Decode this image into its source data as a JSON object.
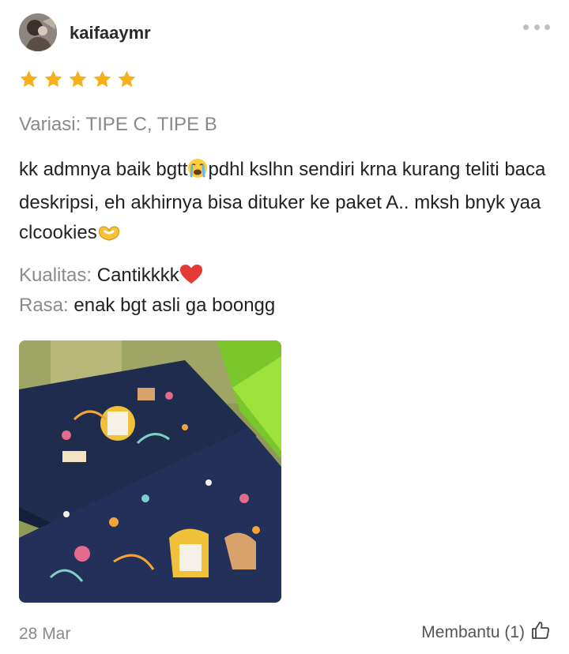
{
  "review": {
    "username": "kaifaaymr",
    "rating": 5,
    "rating_max": 5,
    "variation": "Variasi: TIPE C, TIPE B",
    "text": "kk admnya baik bgtt😭pdhl kslhn sendiri krna kurang teliti baca deskripsi, eh akhirnya bisa dituker ke paket A.. mksh bnyk yaa clcookies🫶",
    "text_parts": {
      "part1": "kk admnya baik bgtt",
      "part2": "pdhl kslhn sendiri krna kurang teliti baca deskripsi, eh akhirnya bisa dituker ke paket A.. mksh bnyk yaa clcookies"
    },
    "attributes": [
      {
        "label": "Kualitas:",
        "value": "Cantikkkk"
      },
      {
        "label": "Rasa:",
        "value": "enak bgt asli ga boongg"
      }
    ],
    "date": "28 Mar",
    "helpful_label": "Membantu (1)"
  },
  "icons": {
    "more": "more-dots-icon",
    "star": "star-icon",
    "crying": "crying-emoji-icon",
    "heart_hands": "heart-hands-emoji-icon",
    "heart": "red-heart-emoji-icon",
    "thumbs_up": "thumbs-up-icon"
  },
  "colors": {
    "star": "#f6b01b",
    "muted_text": "#8a8a8a",
    "body_text": "#222222"
  }
}
